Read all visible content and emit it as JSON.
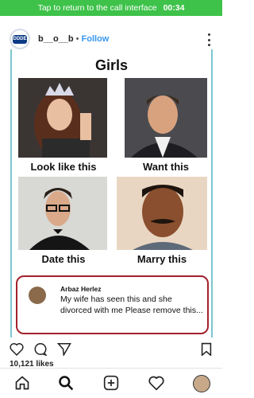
{
  "call_bar": {
    "text": "Tap to return to the call interface",
    "time": "00:34"
  },
  "header": {
    "username": "b__o__b",
    "follow_label": "Follow",
    "avatar_text": "DDDE"
  },
  "post": {
    "title": "Girls",
    "captions": [
      "Look like this",
      "Want this",
      "Date this",
      "Marry this"
    ]
  },
  "comment": {
    "author": "Arbaz Herlez",
    "text": "My wife has seen this and she divorced with me Please remove this..."
  },
  "likes": "10,121 likes",
  "icons": [
    "heart-icon",
    "comment-icon",
    "share-icon",
    "bookmark-icon",
    "home-icon",
    "search-icon",
    "add-icon",
    "heart-nav-icon",
    "profile-icon"
  ],
  "colors": {
    "call_bar": "#3ec24a",
    "follow": "#3897f0",
    "comment_border": "#a3222e",
    "post_border": "#7cc7cf"
  }
}
